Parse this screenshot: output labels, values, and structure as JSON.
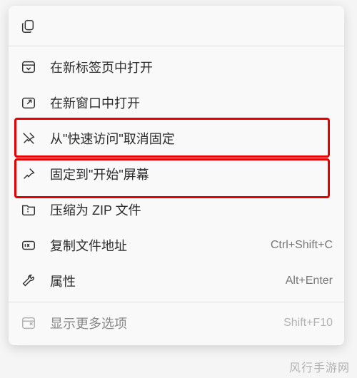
{
  "menu": {
    "top_icon": "copy-icon",
    "items": [
      {
        "icon": "open-new-tab-icon",
        "label": "在新标签页中打开",
        "shortcut": ""
      },
      {
        "icon": "open-new-window-icon",
        "label": "在新窗口中打开",
        "shortcut": ""
      },
      {
        "icon": "unpin-icon",
        "label": "从\"快速访问\"取消固定",
        "shortcut": ""
      },
      {
        "icon": "pin-icon",
        "label": "固定到\"开始\"屏幕",
        "shortcut": ""
      },
      {
        "icon": "zip-icon",
        "label": "压缩为 ZIP 文件",
        "shortcut": ""
      },
      {
        "icon": "copy-path-icon",
        "label": "复制文件地址",
        "shortcut": "Ctrl+Shift+C"
      },
      {
        "icon": "properties-icon",
        "label": "属性",
        "shortcut": "Alt+Enter"
      },
      {
        "icon": "more-options-icon",
        "label": "显示更多选项",
        "shortcut": "Shift+F10",
        "faded": true
      }
    ]
  },
  "watermark": "风行手游网",
  "highlighted_indices": [
    2,
    3
  ]
}
